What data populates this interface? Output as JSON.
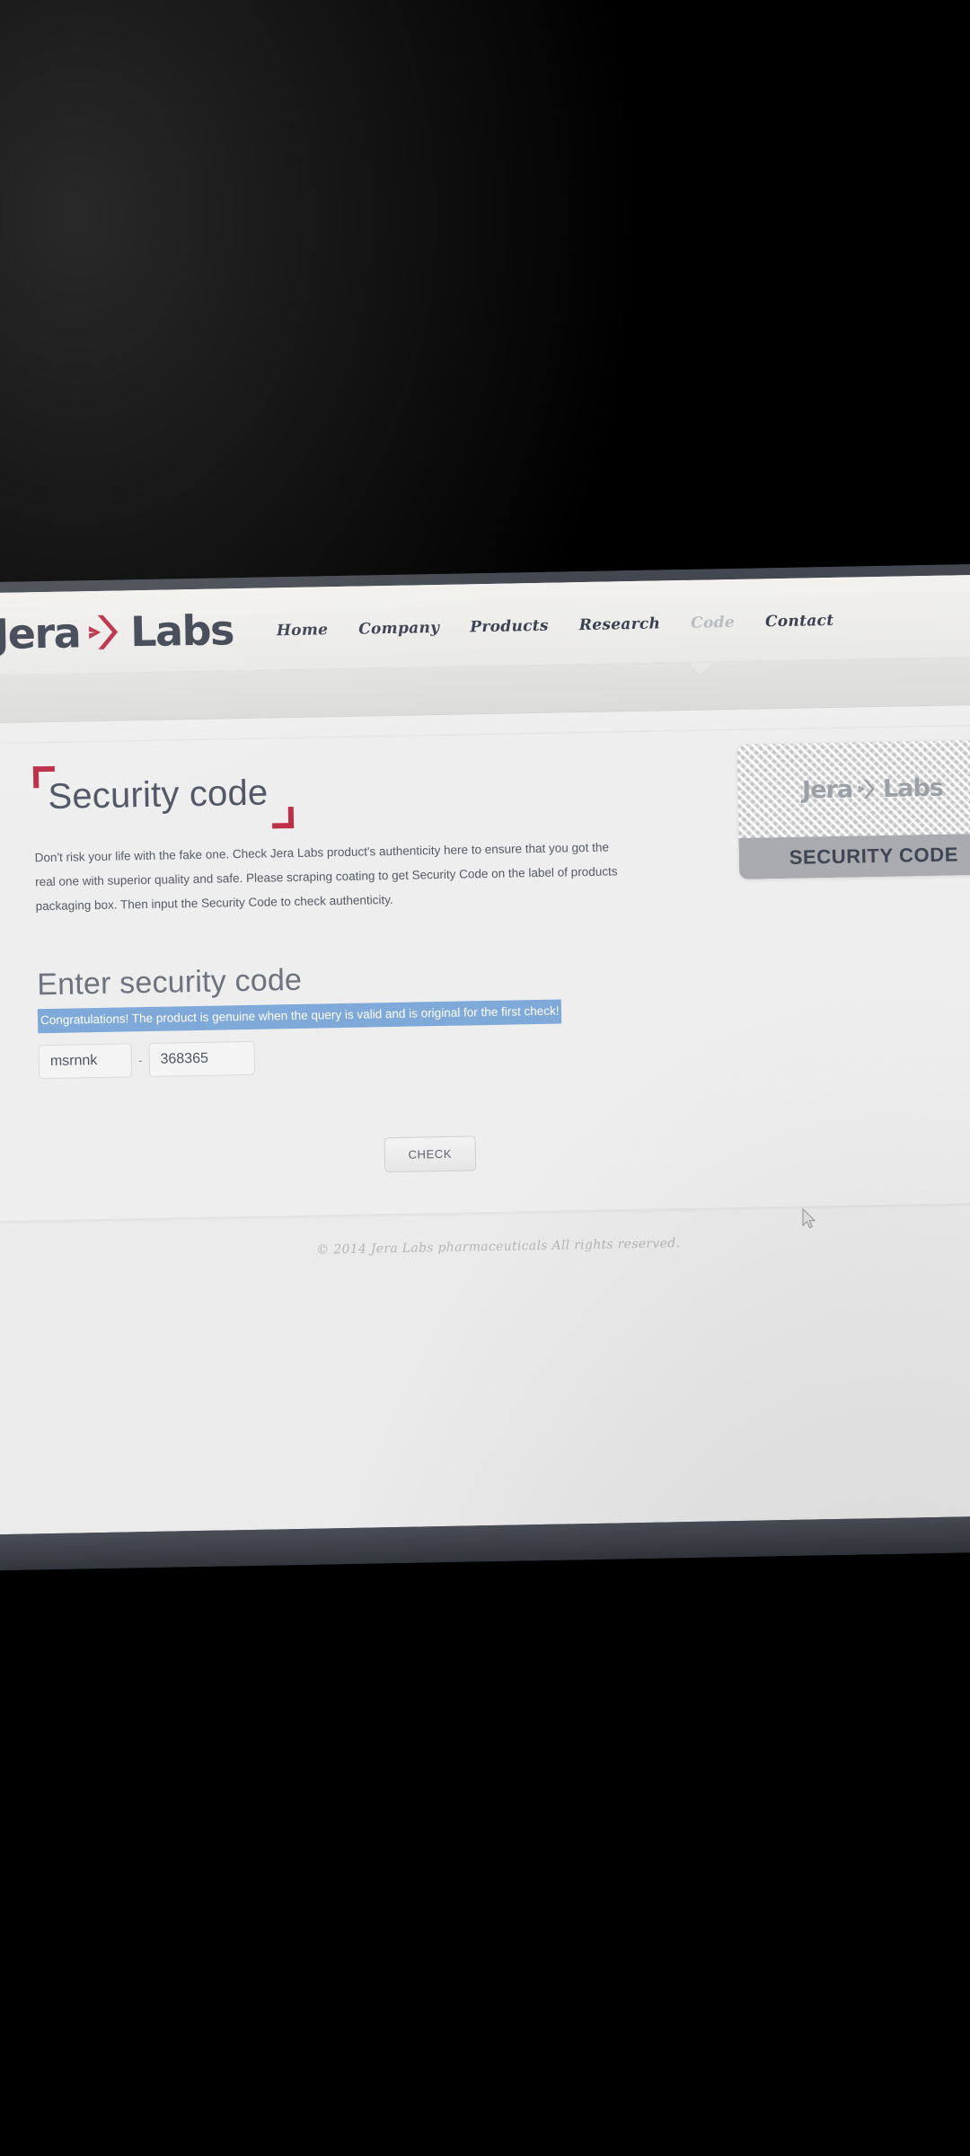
{
  "brand": {
    "name_part1": "Jera",
    "name_part2": "Labs",
    "mark_icon": "double-chevron-icon",
    "accent_color": "#bd2b45",
    "text_color": "#3e4450"
  },
  "nav": {
    "items": [
      {
        "label": "Home",
        "active": false
      },
      {
        "label": "Company",
        "active": false
      },
      {
        "label": "Products",
        "active": false
      },
      {
        "label": "Research",
        "active": false
      },
      {
        "label": "Code",
        "active": true
      },
      {
        "label": "Contact",
        "active": false
      }
    ]
  },
  "page": {
    "title": "Security code",
    "intro": "Don't risk your life with the fake one. Check Jera Labs product's authenticity here to ensure that you got the real one with superior quality and safe. Please scraping coating to get Security Code on the label of products packaging box. Then input the Security Code to check authenticity."
  },
  "form": {
    "heading": "Enter security code",
    "result_message": "Congratulations! The product is genuine when the query is valid and is original for the first check!",
    "result_highlight_color": "#7fa9d8",
    "code_prefix_value": "msrnnk",
    "code_prefix_placeholder": "",
    "separator": "-",
    "code_suffix_value": "368365",
    "code_suffix_placeholder": "",
    "submit_label": "CHECK"
  },
  "scratch_card": {
    "logo_part1": "Jera",
    "logo_part2": "Labs",
    "mark_icon": "double-chevron-icon",
    "band_label": "SECURITY CODE"
  },
  "footer": {
    "copyright": "© 2014 Jera Labs pharmaceuticals All rights reserved."
  },
  "cursor": {
    "icon": "mouse-pointer-icon"
  }
}
